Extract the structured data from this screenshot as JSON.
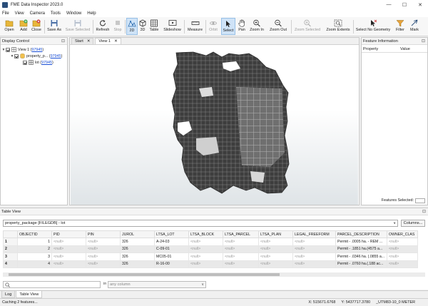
{
  "app": {
    "title": "FME Data Inspector 2023.0"
  },
  "window_controls": {
    "minimize": "—",
    "maximize": "☐",
    "close": "✕"
  },
  "menu": [
    "File",
    "View",
    "Camera",
    "Tools",
    "Window",
    "Help"
  ],
  "toolbar": {
    "open": "Open",
    "add": "Add",
    "close": "Close",
    "save_as": "Save As",
    "save_selected": "Save Selected",
    "refresh": "Refresh",
    "stop": "Stop",
    "view_2d": "2D",
    "view_3d": "3D",
    "table": "Table",
    "slideshow": "Slideshow",
    "measure": "Measure",
    "orbit": "Orbit",
    "select": "Select",
    "pan": "Pan",
    "zoom_in": "Zoom In",
    "zoom_out": "Zoom Out",
    "zoom_selected": "Zoom Selected",
    "zoom_extents": "Zoom Extents",
    "select_no_geometry": "Select No Geometry",
    "filter": "Filter",
    "mark": "Mark"
  },
  "display_control": {
    "title": "Display Control",
    "pin": "⊡",
    "tree": [
      {
        "label": "View 1",
        "count": "97945"
      },
      {
        "label": "property_p...",
        "count": "97945"
      },
      {
        "label": "lot",
        "count": "97945"
      }
    ]
  },
  "view_tabs": [
    {
      "label": "Start",
      "close": "✕"
    },
    {
      "label": "View 1",
      "close": "✕"
    }
  ],
  "feature_info": {
    "title": "Feature Information",
    "pin": "⊡",
    "col_property": "Property",
    "col_value": "Value",
    "features_selected": "Features Selected:"
  },
  "table_view": {
    "title": "Table View",
    "pin": "⊡",
    "dataset": "property_package [FILEGDB] - lot",
    "caret": "∨",
    "columns_button": "Columns...",
    "headers": [
      "",
      "OBJECTID",
      "PID",
      "PIN",
      "JUROL",
      "LTSA_LOT",
      "LTSA_BLOCK",
      "LTSA_PARCEL",
      "LTSA_PLAN",
      "LEGAL_FREEFORM",
      "PARCEL_DESCRIPTION",
      "OWNER_CLAS"
    ],
    "rows": [
      [
        "1",
        "1",
        "<null>",
        "<null>",
        "326",
        "A-24-03",
        "<null>",
        "<null>",
        "<null>",
        "<null>",
        "Permit - .0005 ha. - REM ...",
        "<null>"
      ],
      [
        "2",
        "2",
        "<null>",
        "<null>",
        "326",
        "C-09-01",
        "<null>",
        "<null>",
        "<null>",
        "<null>",
        "Permit - .1851 ha.(4575 a...",
        "<null>"
      ],
      [
        "3",
        "3",
        "<null>",
        "<null>",
        "326",
        "MC05-01",
        "<null>",
        "<null>",
        "<null>",
        "<null>",
        "Permit - .0346 ha. (.0855 a...",
        "<null>"
      ],
      [
        "4",
        "4",
        "<null>",
        "<null>",
        "326",
        "R-16-00",
        "<null>",
        "<null>",
        "<null>",
        "<null>",
        "Permit - .0760 ha.(.188 ac...",
        "<null>"
      ]
    ]
  },
  "search": {
    "in_label": "in",
    "column_placeholder": "any column",
    "caret": "∨"
  },
  "bottom_tabs": [
    "Log",
    "Table View"
  ],
  "status": {
    "message": "Caching 2 features...",
    "x_label": "X:",
    "x_value": "515671.6768",
    "y_label": "Y:",
    "y_value": "5437717.3780",
    "crs": "_UTM83-10_0 METER"
  },
  "colors": {
    "accent": "#2b6cb0",
    "map_polygons": "#3a3a3a",
    "map_edges": "#9a9a9a"
  }
}
